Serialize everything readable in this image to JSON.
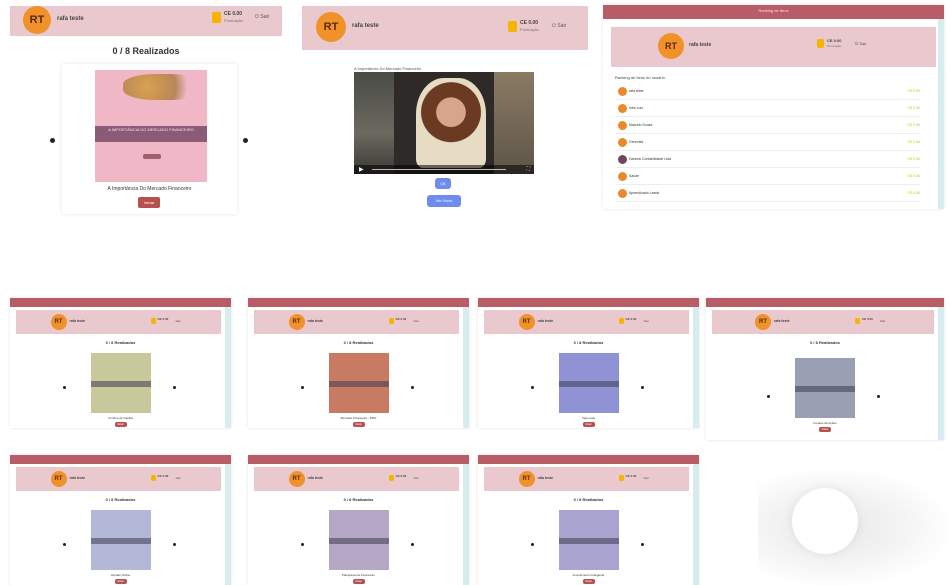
{
  "user": {
    "initials": "RT",
    "name": "rafa teste",
    "points": "CE 0.00",
    "points_sub": "Pontuação",
    "logout": "Sair"
  },
  "panel_catalog": {
    "counter": "0 / 8 Realizados",
    "caption": "A Importância Do Mercado Financeiro",
    "banner_text": "A IMPORTÂNCIA DO MERCADO FINANCEIRO",
    "button": "Iniciar",
    "colors": {
      "banner": "#f0b7c6",
      "strip": "#8a5a76"
    }
  },
  "panel_video": {
    "video_title": "A Importância Do Mercado Financeiro",
    "button_primary": "Ok",
    "button_secondary": "Ver Novo"
  },
  "panel_ranking": {
    "header_title": "Ranking de Itens",
    "list_title": "Ranking de Itens do usuário",
    "rows": [
      {
        "name": "rafa teste",
        "value": "CE 0.00"
      },
      {
        "name": "Inês Luiz",
        "value": "CE 0.00"
      },
      {
        "name": "Marcelo Souza",
        "value": "CE 0.00"
      },
      {
        "name": "Gerentes",
        "value": "CE 0.00"
      },
      {
        "name": "Daniela Contabilidade Ltda",
        "value": "CE 0.00"
      },
      {
        "name": "Saúde",
        "value": "CE 0.00"
      },
      {
        "name": "Aprendizado Leads",
        "value": "CE 0.00"
      }
    ]
  },
  "small_panels": [
    {
      "counter": "0 / 8 Realizados",
      "caption": "Fundos de Capital",
      "color": "#c8c99a",
      "button": "Iniciar"
    },
    {
      "counter": "0 / 8 Realizados",
      "caption": "Mercado Financeiro - PRO",
      "color": "#c97a62",
      "button": "Iniciar"
    },
    {
      "counter": "0 / 8 Realizados",
      "caption": "Veja mais",
      "color": "#8f93d6",
      "button": "Iniciar"
    },
    {
      "counter": "0 / 8 Realizados",
      "caption": "Fundos de Ações",
      "color": "#9aa0b4",
      "button": "Iniciar"
    },
    {
      "counter": "0 / 8 Realizados",
      "caption": "Vendas Online",
      "color": "#b4b8d8",
      "button": "Iniciar"
    },
    {
      "counter": "0 / 8 Realizados",
      "caption": "Planejamento Financeiro",
      "color": "#b7a7c6",
      "button": "Iniciar"
    },
    {
      "counter": "0 / 8 Realizados",
      "caption": "Investimento Inteligente",
      "color": "#a8a4cf",
      "button": "Iniciar"
    }
  ]
}
